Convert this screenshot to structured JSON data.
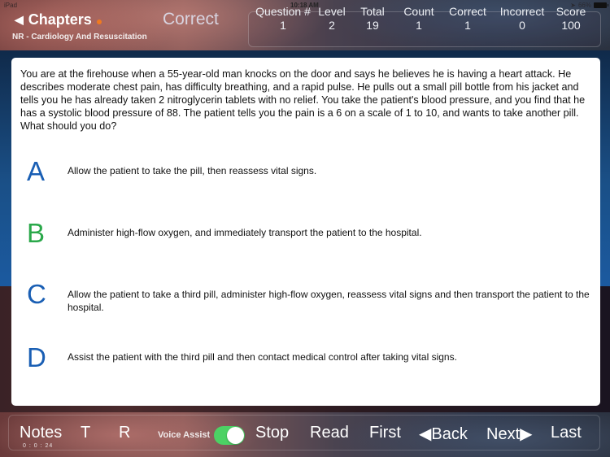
{
  "status_bar": {
    "device": "iPad",
    "time": "10:18 AM",
    "battery": "66%"
  },
  "header": {
    "back_label": "Chapters",
    "chapter_name": "NR - Cardiology And Resuscitation",
    "result": "Correct"
  },
  "stats": [
    {
      "label": "Question #",
      "value": "1"
    },
    {
      "label": "Level",
      "value": "2"
    },
    {
      "label": "Total",
      "value": "19"
    },
    {
      "label": "Count",
      "value": "1"
    },
    {
      "label": "Correct",
      "value": "1"
    },
    {
      "label": "Incorrect",
      "value": "0"
    },
    {
      "label": "Score",
      "value": "100"
    }
  ],
  "question": {
    "text": "You are at the firehouse when a 55-year-old man knocks on the door and says he believes he is having a heart attack. He describes moderate chest pain, has difficulty breathing, and a rapid pulse. He pulls out a small pill bottle from his jacket and tells you he has already taken 2 nitroglycerin tablets with no relief. You take the patient's blood pressure, and you find that he has a systolic blood pressure of 88.  The patient tells you the pain is a 6 on a scale of 1 to 10, and wants to take another pill. What should you do?"
  },
  "answers": [
    {
      "letter": "A",
      "text": "Allow the patient to take the pill, then reassess vital signs.",
      "color": "#1a5fb4"
    },
    {
      "letter": "B",
      "text": "Administer high-flow oxygen, and immediately transport the patient to the hospital.",
      "color": "#2aa84a"
    },
    {
      "letter": "C",
      "text": "Allow the patient to take a third pill, administer high-flow oxygen, reassess vital signs and then transport the patient to the hospital.",
      "color": "#1a5fb4"
    },
    {
      "letter": "D",
      "text": "Assist the patient with the third pill and then contact medical control after taking vital signs.",
      "color": "#1a5fb4"
    }
  ],
  "toolbar": {
    "notes": "Notes",
    "timer": "0 : 0 : 24",
    "t": "T",
    "r": "R",
    "voice_assist": "Voice Assist",
    "voice_assist_on": true,
    "stop": "Stop",
    "read": "Read",
    "first": "First",
    "back": "◀Back",
    "next": "Next▶",
    "last": "Last"
  }
}
